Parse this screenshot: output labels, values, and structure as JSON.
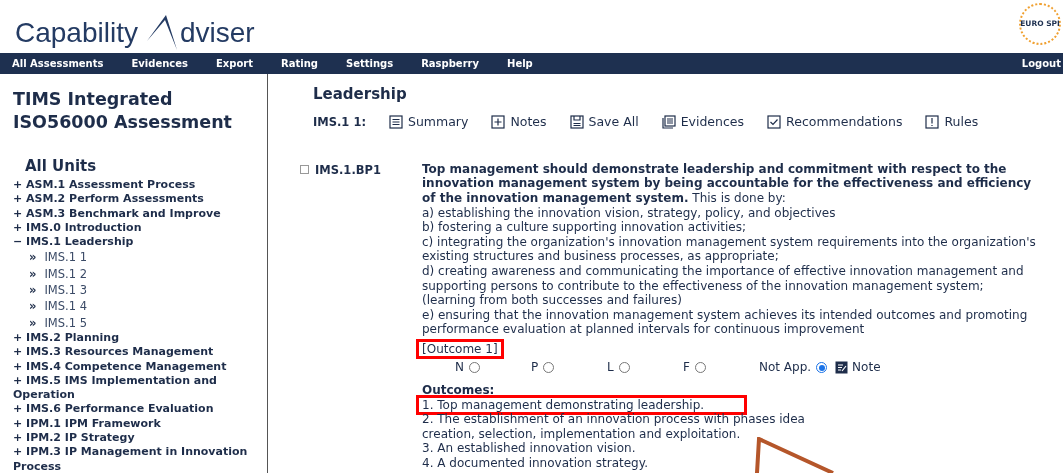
{
  "logo": {
    "before": "Capability",
    "after": "dviser"
  },
  "partner_logo": "EURO SPI",
  "nav": {
    "items": [
      "All Assessments",
      "Evidences",
      "Export",
      "Rating",
      "Settings",
      "Raspberry",
      "Help"
    ],
    "logout": "Logout"
  },
  "sidebar": {
    "title": "TIMS Integrated ISO56000 Assessment",
    "units_heading": "All Units",
    "units": [
      {
        "toggle": "+",
        "label": "ASM.1 Assessment Process"
      },
      {
        "toggle": "+",
        "label": "ASM.2 Perform Assessments"
      },
      {
        "toggle": "+",
        "label": "ASM.3 Benchmark and Improve"
      },
      {
        "toggle": "+",
        "label": "IMS.0 Introduction"
      },
      {
        "toggle": "−",
        "label": "IMS.1 Leadership",
        "children": [
          {
            "marker": "»",
            "label": "IMS.1 1"
          },
          {
            "marker": "»",
            "label": "IMS.1 2"
          },
          {
            "marker": "»",
            "label": "IMS.1 3"
          },
          {
            "marker": "»",
            "label": "IMS.1 4"
          },
          {
            "marker": "»",
            "label": "IMS.1 5"
          }
        ]
      },
      {
        "toggle": "+",
        "label": "IMS.2 Planning"
      },
      {
        "toggle": "+",
        "label": "IMS.3 Resources Management"
      },
      {
        "toggle": "+",
        "label": "IMS.4 Competence Management"
      },
      {
        "toggle": "+",
        "label": "IMS.5 IMS Implementation and Operation"
      },
      {
        "toggle": "+",
        "label": "IMS.6 Performance Evaluation"
      },
      {
        "toggle": "+",
        "label": "IPM.1 IPM Framework"
      },
      {
        "toggle": "+",
        "label": "IPM.2 IP Strategy"
      },
      {
        "toggle": "+",
        "label": "IPM.3 IP Management in Innovation Process"
      }
    ]
  },
  "main": {
    "heading": "Leadership",
    "toolbar_label": "IMS.1 1:",
    "tools": [
      {
        "kind": "summary",
        "label": "Summary"
      },
      {
        "kind": "notes",
        "label": "Notes"
      },
      {
        "kind": "save",
        "label": "Save All"
      },
      {
        "kind": "evidences",
        "label": "Evidences"
      },
      {
        "kind": "recommendations",
        "label": "Recommendations"
      },
      {
        "kind": "rules",
        "label": "Rules"
      }
    ],
    "practice": {
      "checked": false,
      "id": "IMS.1.BP1",
      "statement": "**Top management should demonstrate leadership and commitment with respect to the innovation management system by being accountable for the effectiveness and efficiency of the innovation management system.** This is done by:",
      "lines": [
        "a) establishing the innovation vision, strategy, policy, and objectives",
        "b) fostering a culture supporting innovation activities;",
        "c) integrating the organization's innovation management system requirements into the organization's existing structures and business processes, as appropriate;",
        "d) creating awareness and communicating the importance of effective innovation management and supporting persons to contribute to the effectiveness of the innovation management system;",
        "(learning from both successes and failures)",
        "e) ensuring that the innovation management system achieves its intended outcomes and promoting performance evaluation at planned intervals for continuous improvement"
      ],
      "outcome_ref": {
        "text": "[Outcome 1]",
        "highlighted": true
      },
      "ratings": [
        {
          "label": "N",
          "selected": false
        },
        {
          "label": "P",
          "selected": false
        },
        {
          "label": "L",
          "selected": false
        },
        {
          "label": "F",
          "selected": false
        },
        {
          "label": "Not App.",
          "selected": true
        }
      ],
      "note": "Note",
      "outcomes_heading": "Outcomes:",
      "outcomes": [
        {
          "text": "1. Top management demonstrating leadership.",
          "highlighted": true
        },
        {
          "text": "2. The establishment of an innovation process with phases idea\ncreation, selection, implementation and exploitation.",
          "highlighted": false
        },
        {
          "text": "3. An established innovation vision.",
          "highlighted": false
        },
        {
          "text": "4. A documented innovation strategy.",
          "highlighted": false
        }
      ]
    }
  }
}
